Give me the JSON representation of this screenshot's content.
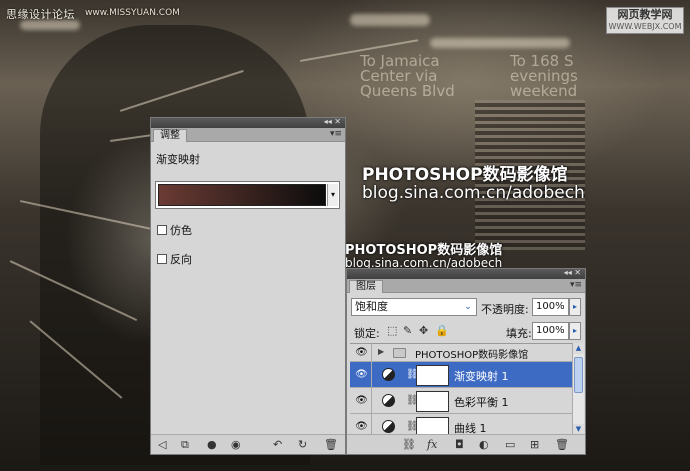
{
  "watermarks": {
    "top_left": "思缘设计论坛",
    "top_left_url": "www.MISSYUAN.COM",
    "top_right_line1": "网页教学网",
    "top_right_line2": "WWW.WEBJX.COM",
    "ps_title_1": "PHOTOSHOP数码影像馆",
    "ps_url_1": "blog.sina.com.cn/adobech",
    "ps_title_2": "PHOTOSHOP数码影像馆",
    "ps_url_2": "blog.sina.com.cn/adobech"
  },
  "background_signs": {
    "line1": "To Jamaica",
    "line2": "Center via",
    "line3": "Queens Blvd",
    "right1": "To 168 S",
    "right2": "evenings",
    "right3": "weekend"
  },
  "adjustments": {
    "tab_label": "调整",
    "heading": "渐变映射",
    "gradient": {
      "from": "#6b3b34",
      "to": "#0c0c0c"
    },
    "dither_label": "仿色",
    "reverse_label": "反向",
    "dither_checked": false,
    "reverse_checked": false
  },
  "layers": {
    "tab_label": "图层",
    "blend_mode": "饱和度",
    "opacity_label": "不透明度:",
    "opacity_value": "100%",
    "lock_label": "锁定:",
    "fill_label": "填充:",
    "fill_value": "100%",
    "items": [
      {
        "name": "PHOTOSHOP数码影像馆",
        "type": "group",
        "visible": true
      },
      {
        "name": "渐变映射 1",
        "type": "adjustment",
        "visible": true,
        "selected": true
      },
      {
        "name": "色彩平衡 1",
        "type": "adjustment",
        "visible": true
      },
      {
        "name": "曲线 1",
        "type": "adjustment",
        "visible": true
      }
    ]
  },
  "colors": {
    "selection": "#3d6bc4",
    "panel": "#d6d6d6"
  }
}
